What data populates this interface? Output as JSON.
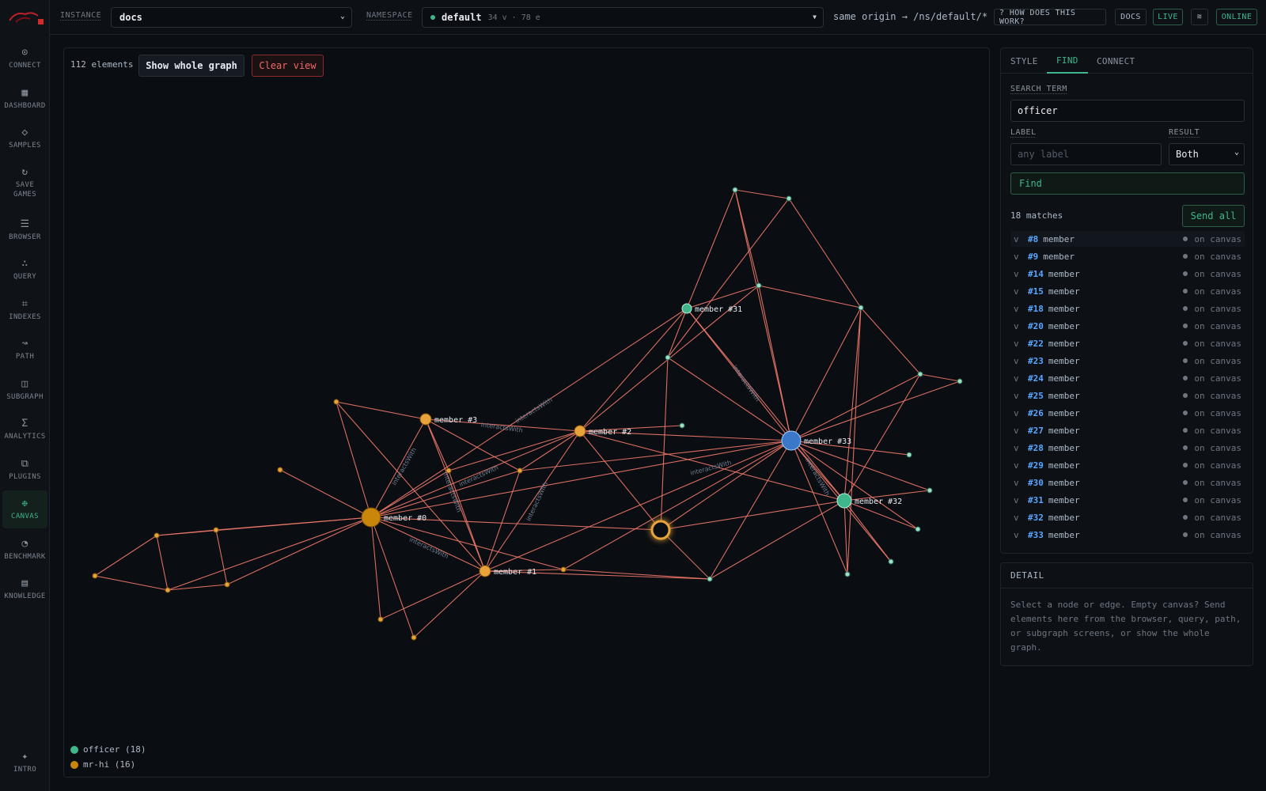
{
  "sidebar": {
    "items": [
      {
        "label": "CONNECT",
        "icon": "connect-icon",
        "glyph": "⊙"
      },
      {
        "label": "DASHBOARD",
        "icon": "dashboard-icon",
        "glyph": "▦"
      },
      {
        "label": "SAMPLES",
        "icon": "samples-icon",
        "glyph": "◇"
      },
      {
        "label": "SAVE GAMES",
        "icon": "refresh-icon",
        "glyph": "↻"
      },
      {
        "label": "BROWSER",
        "icon": "list-icon",
        "glyph": "☰"
      },
      {
        "label": "QUERY",
        "icon": "query-icon",
        "glyph": "∴"
      },
      {
        "label": "INDEXES",
        "icon": "frame-icon",
        "glyph": "⌗"
      },
      {
        "label": "PATH",
        "icon": "path-icon",
        "glyph": "↝"
      },
      {
        "label": "SUBGRAPH",
        "icon": "subgraph-icon",
        "glyph": "◫"
      },
      {
        "label": "ANALYTICS",
        "icon": "sigma-icon",
        "glyph": "Σ"
      },
      {
        "label": "PLUGINS",
        "icon": "plugins-icon",
        "glyph": "⧉"
      },
      {
        "label": "CANVAS",
        "icon": "canvas-icon",
        "glyph": "❉"
      },
      {
        "label": "BENCHMARK",
        "icon": "gauge-icon",
        "glyph": "◔"
      },
      {
        "label": "KNOWLEDGE",
        "icon": "book-icon",
        "glyph": "▤"
      }
    ],
    "intro": {
      "label": "INTRO",
      "icon": "sparkle-icon",
      "glyph": "✦"
    }
  },
  "topbar": {
    "instance_label": "INSTANCE",
    "instance_value": "docs",
    "namespace_label": "NAMESPACE",
    "namespace_value": "default",
    "namespace_meta": "34 v · 78 e",
    "origin": "same origin → /ns/default/*",
    "help": "? HOW DOES THIS WORK?",
    "docs": "DOCS",
    "live": "LIVE",
    "online": "ONLINE"
  },
  "canvas": {
    "element_count": "112 elements",
    "show_whole_graph": "Show whole graph",
    "clear_view": "Clear view",
    "legend": [
      {
        "label": "officer (18)",
        "color": "#3fb68b"
      },
      {
        "label": "mr-hi (16)",
        "color": "#c9860a"
      }
    ],
    "colors": {
      "edge": "#f0796b",
      "officer": "#9fe0c8",
      "mrhi": "#e8a43a"
    },
    "edge_label": "interactsWith",
    "node_labels": {
      "m0": "member #0",
      "m1": "member #1",
      "m2": "member #2",
      "m3": "member #3",
      "m31": "member #31",
      "m32": "member #32",
      "m33": "member #33"
    }
  },
  "panel": {
    "tabs": [
      "STYLE",
      "FIND",
      "CONNECT"
    ],
    "search_label": "SEARCH TERM",
    "search_value": "officer",
    "label_label": "LABEL",
    "label_placeholder": "any label",
    "result_label": "RESULT",
    "result_value": "Both",
    "find": "Find",
    "matches": "18 matches",
    "send_all": "Send all",
    "results": [
      {
        "id": "#8",
        "label": "member"
      },
      {
        "id": "#9",
        "label": "member"
      },
      {
        "id": "#14",
        "label": "member"
      },
      {
        "id": "#15",
        "label": "member"
      },
      {
        "id": "#18",
        "label": "member"
      },
      {
        "id": "#20",
        "label": "member"
      },
      {
        "id": "#22",
        "label": "member"
      },
      {
        "id": "#23",
        "label": "member"
      },
      {
        "id": "#24",
        "label": "member"
      },
      {
        "id": "#25",
        "label": "member"
      },
      {
        "id": "#26",
        "label": "member"
      },
      {
        "id": "#27",
        "label": "member"
      },
      {
        "id": "#28",
        "label": "member"
      },
      {
        "id": "#29",
        "label": "member"
      },
      {
        "id": "#30",
        "label": "member"
      },
      {
        "id": "#31",
        "label": "member"
      },
      {
        "id": "#32",
        "label": "member"
      },
      {
        "id": "#33",
        "label": "member"
      }
    ],
    "result_kind": "v",
    "result_status": "on canvas"
  },
  "detail": {
    "title": "DETAIL",
    "text": "Select a node or edge. Empty canvas? Send elements here from the browser, query, path, or subgraph screens, or show the whole graph."
  }
}
